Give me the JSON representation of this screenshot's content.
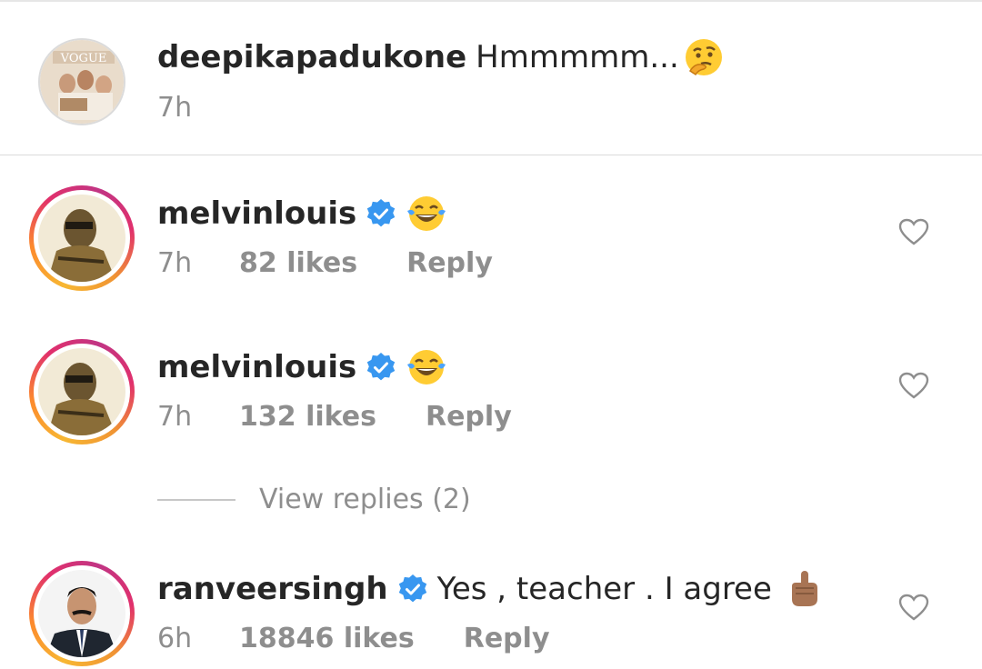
{
  "caption": {
    "username": "deepikapadukone",
    "text": "Hmmmmm...",
    "emoji": "thinking-face",
    "time": "7h"
  },
  "comments": [
    {
      "username": "melvinlouis",
      "verified": true,
      "emoji": "tears-of-joy",
      "time": "7h",
      "likes": "82 likes",
      "reply": "Reply"
    },
    {
      "username": "melvinlouis",
      "verified": true,
      "emoji": "tears-of-joy",
      "time": "7h",
      "likes": "132 likes",
      "reply": "Reply"
    },
    {
      "username": "ranveersingh",
      "verified": true,
      "text": "Yes , teacher . I agree",
      "emoji": "index-pointing-up-medium-dark",
      "time": "6h",
      "likes": "18846 likes",
      "reply": "Reply"
    }
  ],
  "view_replies": "View replies (2)",
  "colors": {
    "verified": "#3897f0",
    "meta": "#8e8e8e",
    "text": "#262626"
  }
}
